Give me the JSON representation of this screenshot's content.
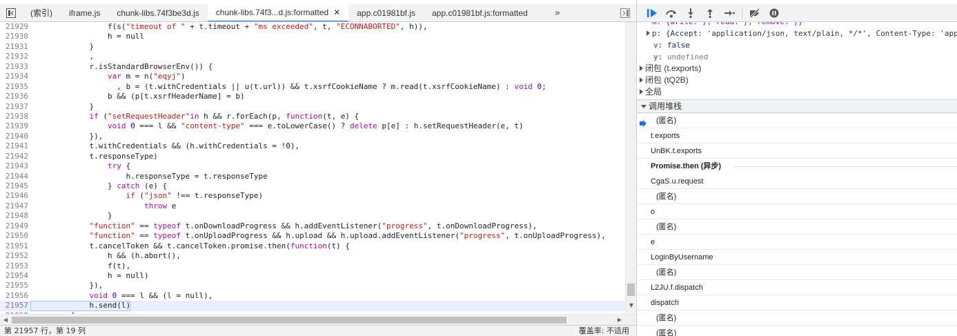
{
  "editor": {
    "tabs": [
      {
        "label": "(索引)",
        "active": false,
        "closable": false
      },
      {
        "label": "iframe.js",
        "active": false,
        "closable": false
      },
      {
        "label": "chunk-libs.74f3be3d.js",
        "active": false,
        "closable": false
      },
      {
        "label": "chunk-libs.74f3...d.js:formatted",
        "active": true,
        "closable": true
      },
      {
        "label": "app.c01981bf.js",
        "active": false,
        "closable": false
      },
      {
        "label": "app.c01981bf.js:formatted",
        "active": false,
        "closable": false
      }
    ],
    "more_label": "»",
    "close_glyph": "✕",
    "highlighted_line": 21957,
    "lines": [
      {
        "n": "21929",
        "code": "                f(s(\"timeout of \" + t.timeout + \"ms exceeded\", t, \"ECONNABORTED\", h)),"
      },
      {
        "n": "21930",
        "code": "                h = null"
      },
      {
        "n": "21931",
        "code": "            }"
      },
      {
        "n": "21932",
        "code": "            ,"
      },
      {
        "n": "21933",
        "code": "            r.isStandardBrowserEnv()) {"
      },
      {
        "n": "21934",
        "code": "                var m = n(\"eqyj\")"
      },
      {
        "n": "21935",
        "code": "                  , b = (t.withCredentials || u(t.url)) && t.xsrfCookieName ? m.read(t.xsrfCookieName) : void 0;"
      },
      {
        "n": "21936",
        "code": "                b && (p[t.xsrfHeaderName] = b)"
      },
      {
        "n": "21937",
        "code": "            }"
      },
      {
        "n": "21938",
        "code": "            if (\"setRequestHeader\"in h && r.forEach(p, function(t, e) {"
      },
      {
        "n": "21939",
        "code": "                void 0 === l && \"content-type\" === e.toLowerCase() ? delete p[e] : h.setRequestHeader(e, t)"
      },
      {
        "n": "21940",
        "code": "            }),"
      },
      {
        "n": "21941",
        "code": "            t.withCredentials && (h.withCredentials = !0),"
      },
      {
        "n": "21942",
        "code": "            t.responseType)"
      },
      {
        "n": "21943",
        "code": "                try {"
      },
      {
        "n": "21944",
        "code": "                    h.responseType = t.responseType"
      },
      {
        "n": "21945",
        "code": "                } catch (e) {"
      },
      {
        "n": "21946",
        "code": "                    if (\"json\" !== t.responseType)"
      },
      {
        "n": "21947",
        "code": "                        throw e"
      },
      {
        "n": "21948",
        "code": "                }"
      },
      {
        "n": "21949",
        "code": "            \"function\" == typeof t.onDownloadProgress && h.addEventListener(\"progress\", t.onDownloadProgress),"
      },
      {
        "n": "21950",
        "code": "            \"function\" == typeof t.onUploadProgress && h.upload && h.upload.addEventListener(\"progress\", t.onUploadProgress),"
      },
      {
        "n": "21951",
        "code": "            t.cancelToken && t.cancelToken.promise.then(function(t) {"
      },
      {
        "n": "21952",
        "code": "                h && (h.abort(),"
      },
      {
        "n": "21953",
        "code": "                f(t),"
      },
      {
        "n": "21954",
        "code": "                h = null)"
      },
      {
        "n": "21955",
        "code": "            }),"
      },
      {
        "n": "21956",
        "code": "            void 0 === l && (l = null),"
      },
      {
        "n": "21957",
        "code": "            h.send(l)"
      },
      {
        "n": "21958",
        "code": "        }"
      }
    ],
    "status_left": "第 21957 行，第 19 列",
    "status_right": "覆盖率: 不适用"
  },
  "scope": {
    "rows": [
      {
        "type": "partial",
        "text": "m: {write: ƒ, read: ƒ, remove: ƒ}"
      },
      {
        "type": "prop-expandable",
        "key": "p",
        "value": "{Accept: 'application/json, text/plain, */*', Content-Type: 'app"
      },
      {
        "type": "prop",
        "key": "v",
        "value": "false",
        "vtype": "kw"
      },
      {
        "type": "prop",
        "key": "y",
        "value": "undefined",
        "vtype": "undef"
      },
      {
        "type": "scope",
        "label": "闭包 (t.exports)"
      },
      {
        "type": "scope",
        "label": "闭包 (tQ2B)"
      },
      {
        "type": "scope",
        "label": "全局"
      }
    ]
  },
  "callstack": {
    "header": "调用堆栈",
    "frames": [
      {
        "label": "(匿名)",
        "kind": "anon",
        "current": true
      },
      {
        "label": "t.exports",
        "kind": "named"
      },
      {
        "label": "UnBK.t.exports",
        "kind": "named"
      },
      {
        "label": "Promise.then (异步)",
        "kind": "async"
      },
      {
        "label": "CgaS.u.request",
        "kind": "named"
      },
      {
        "label": "(匿名)",
        "kind": "anon"
      },
      {
        "label": "o",
        "kind": "named"
      },
      {
        "label": "(匿名)",
        "kind": "anon"
      },
      {
        "label": "e",
        "kind": "named"
      },
      {
        "label": "LoginByUsername",
        "kind": "named"
      },
      {
        "label": "(匿名)",
        "kind": "anon"
      },
      {
        "label": "L2JU.f.dispatch",
        "kind": "named"
      },
      {
        "label": "dispatch",
        "kind": "named"
      },
      {
        "label": "(匿名)",
        "kind": "anon"
      },
      {
        "label": "(匿名)",
        "kind": "anon"
      }
    ]
  },
  "colors": {
    "accent": "#1a73e8",
    "keyword": "#a60ba6",
    "string": "#c41a16",
    "highlight_line": "#e8eefd"
  },
  "icons": {
    "sidebar_toggle": "navigator-toggle-icon",
    "resume": "resume-icon",
    "step_over": "step-over-icon",
    "step_into": "step-into-icon",
    "step_out": "step-out-icon",
    "step": "step-icon",
    "deactivate_breakpoints": "deactivate-breakpoints-icon",
    "pause_on_exceptions": "pause-exceptions-icon"
  }
}
